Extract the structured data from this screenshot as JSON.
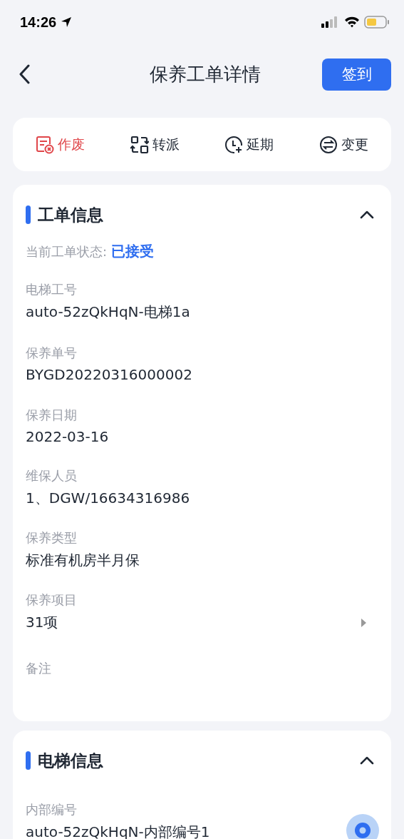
{
  "status_bar": {
    "time": "14:26"
  },
  "nav": {
    "title": "保养工单详情",
    "action": "签到"
  },
  "actions": [
    {
      "label": "作废",
      "kind": "void"
    },
    {
      "label": "转派",
      "kind": "transfer"
    },
    {
      "label": "延期",
      "kind": "delay"
    },
    {
      "label": "变更",
      "kind": "change"
    }
  ],
  "sections": [
    {
      "title": "工单信息",
      "expanded": true,
      "fields": [
        {
          "kind": "status",
          "label": "当前工单状态:",
          "value": "已接受"
        },
        {
          "kind": "text",
          "label": "电梯工号",
          "value": "auto-52zQkHqN-电梯1a"
        },
        {
          "kind": "text",
          "label": "保养单号",
          "value": "BYGD20220316000002"
        },
        {
          "kind": "text",
          "label": "保养日期",
          "value": "2022-03-16"
        },
        {
          "kind": "text",
          "label": "维保人员",
          "value": "1、DGW/16634316986"
        },
        {
          "kind": "text",
          "label": "保养类型",
          "value": "标准有机房半月保"
        },
        {
          "kind": "link",
          "label": "保养项目",
          "value": "31项"
        },
        {
          "kind": "empty",
          "label": "备注"
        }
      ]
    },
    {
      "title": "电梯信息",
      "expanded": true,
      "fields": [
        {
          "kind": "text",
          "label": "内部编号",
          "value": "auto-52zQkHqN-内部编号1"
        }
      ]
    }
  ]
}
